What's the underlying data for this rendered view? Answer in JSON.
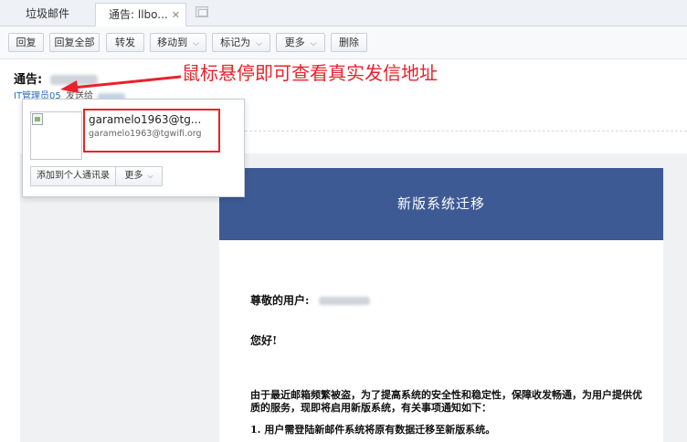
{
  "tabs": {
    "inactive_label": "垃圾邮件",
    "active_label": "通告: llbo...",
    "close_glyph": "✕"
  },
  "toolbar": {
    "reply": "回复",
    "reply_all": "回复全部",
    "forward": "转发",
    "move_to": "移动到",
    "mark_as": "标记为",
    "more": "更多",
    "delete": "删除",
    "caret": "⌵"
  },
  "header": {
    "subject_prefix": "通告:",
    "sender_name": "IT管理员05",
    "sent_to": "发送给"
  },
  "annotation": {
    "text": "鼠标悬停即可查看真实发信地址",
    "color": "#e8222c"
  },
  "popup": {
    "display_name": "garamelo1963@tg...",
    "email": "garamelo1963@tgwifi.org",
    "add_contact": "添加到个人通讯录",
    "more": "更多",
    "caret": "⌵"
  },
  "mail": {
    "banner_title": "新版系统迁移",
    "banner_color": "#3e5a95",
    "greeting": "尊敬的用户:",
    "hello": "您好!",
    "paragraph": "由于最近邮箱频繁被盗，为了提高系统的安全性和稳定性，保障收发畅通，为用户提供优质的服务，现即将启用新版系统，有关事项通知如下：",
    "item1": "1. 用户需登陆新邮件系统将原有数据迁移至新版系统。"
  }
}
